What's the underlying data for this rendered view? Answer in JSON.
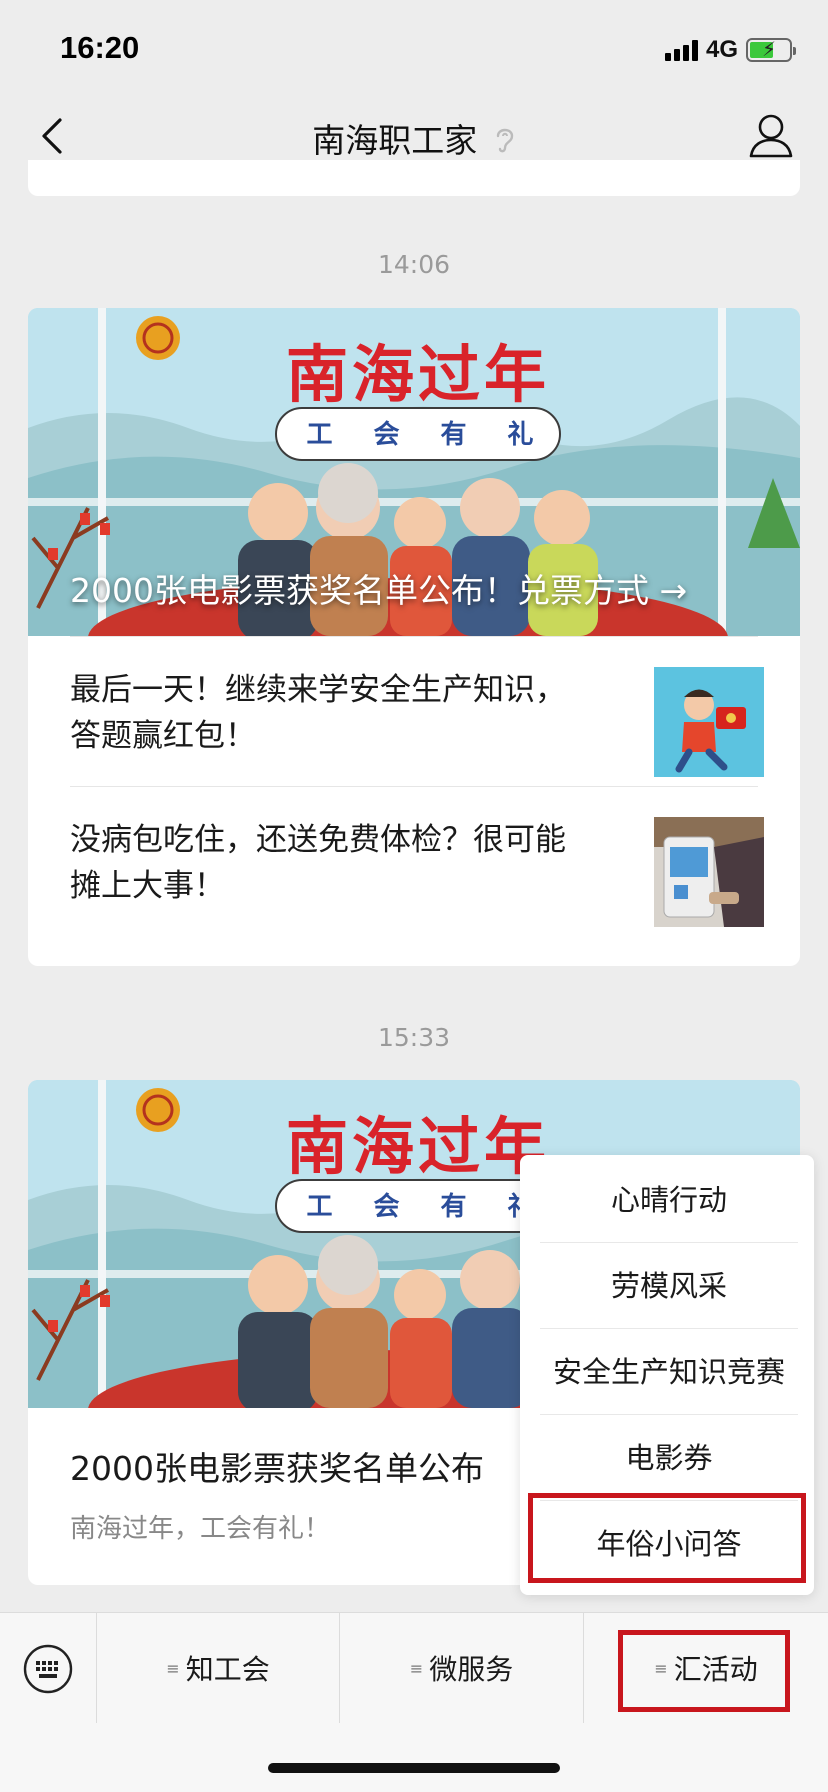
{
  "status_bar": {
    "time": "16:20",
    "network": "4G"
  },
  "nav": {
    "title": "南海职工家"
  },
  "messages": [
    {
      "timestamp": "14:06",
      "banner": {
        "heading": "南海过年",
        "subheading": [
          "工",
          "会",
          "有",
          "礼"
        ],
        "caption": "2000张电影票获奖名单公布！兑票方式 →"
      },
      "sub_articles": [
        {
          "title": "最后一天！继续来学安全生产知识，答题赢红包！"
        },
        {
          "title": "没病包吃住，还送免费体检？很可能摊上大事！"
        }
      ]
    },
    {
      "timestamp": "15:33",
      "banner": {
        "heading": "南海过年",
        "subheading": [
          "工",
          "会",
          "有",
          "礼"
        ]
      },
      "title": "2000张电影票获奖名单公布",
      "digest": "南海过年，工会有礼！"
    }
  ],
  "popup_menu": {
    "items": [
      {
        "label": "心晴行动"
      },
      {
        "label": "劳模风采"
      },
      {
        "label": "安全生产知识竞赛"
      },
      {
        "label": "电影券"
      },
      {
        "label": "年俗小问答"
      }
    ],
    "highlighted_index": 4
  },
  "bottom_menu": {
    "tabs": [
      {
        "label": "知工会"
      },
      {
        "label": "微服务"
      },
      {
        "label": "汇活动"
      }
    ],
    "highlighted_index": 2
  },
  "colors": {
    "highlight_box": "#c8161d",
    "banner_heading": "#d9232a",
    "background": "#ededed"
  }
}
